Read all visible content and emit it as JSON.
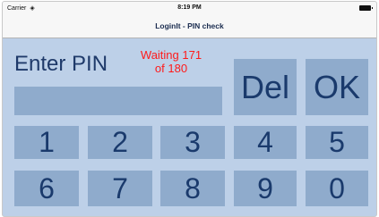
{
  "status_bar": {
    "carrier": "Carrier",
    "wifi_icon": "wifi-icon",
    "time": "8:19 PM",
    "battery_icon": "battery-icon"
  },
  "nav": {
    "title": "LoginIt - PIN check"
  },
  "prompt": {
    "label": "Enter PIN"
  },
  "waiting": {
    "line1": "Waiting 171",
    "line2": "of 180"
  },
  "pin_input": {
    "value": ""
  },
  "actions": {
    "delete": "Del",
    "ok": "OK"
  },
  "keypad": {
    "row1": [
      "1",
      "2",
      "3",
      "4",
      "5"
    ],
    "row2": [
      "6",
      "7",
      "8",
      "9",
      "0"
    ]
  },
  "colors": {
    "background": "#bdd0e8",
    "key": "#8fabcc",
    "key_text": "#1a3a6c",
    "waiting_text": "#ff1a1a"
  }
}
